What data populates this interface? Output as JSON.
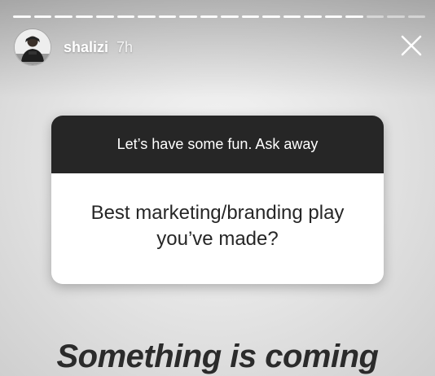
{
  "story": {
    "progress": {
      "segments": 20,
      "viewed": 17
    },
    "header": {
      "username": "shalizi",
      "timestamp": "7h",
      "avatar": "avatar",
      "close_icon": "close-icon"
    },
    "question_sticker": {
      "prompt": "Let’s have some fun. Ask away",
      "question": "Best marketing/branding play you’ve made?",
      "header_color": "#262626",
      "body_color": "#ffffff"
    },
    "caption": "Something is coming"
  }
}
